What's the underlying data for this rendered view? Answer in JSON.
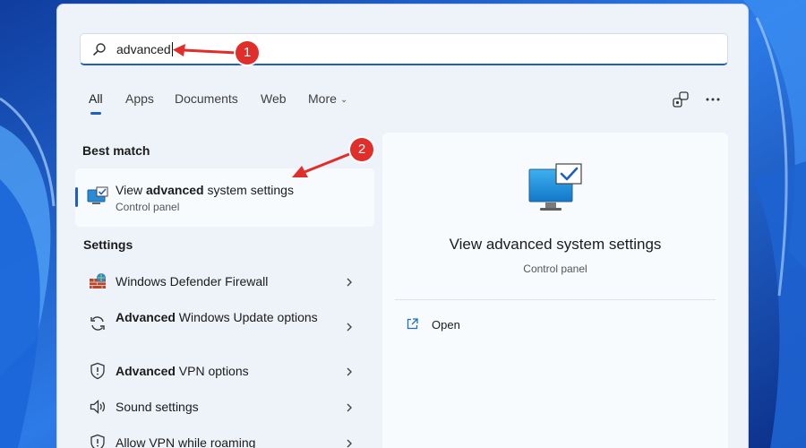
{
  "search": {
    "query": "advanced"
  },
  "tabs": [
    {
      "label": "All",
      "active": true
    },
    {
      "label": "Apps"
    },
    {
      "label": "Documents"
    },
    {
      "label": "Web"
    },
    {
      "label": "More"
    }
  ],
  "best_match": {
    "header": "Best match",
    "title_prefix": "View ",
    "title_highlight": "advanced",
    "title_suffix": " system settings",
    "subtitle": "Control panel"
  },
  "settings": {
    "header": "Settings",
    "items": [
      {
        "highlight": "",
        "label": "Windows Defender Firewall",
        "icon": "firewall-icon"
      },
      {
        "highlight": "Advanced",
        "label": " Windows Update options",
        "icon": "sync-icon"
      },
      {
        "highlight": "Advanced",
        "label": " VPN options",
        "icon": "shield-icon"
      },
      {
        "highlight": "",
        "label": "Sound settings",
        "icon": "speaker-icon"
      },
      {
        "highlight": "",
        "label": "Allow VPN while roaming",
        "icon": "shield-icon"
      }
    ]
  },
  "preview": {
    "title": "View advanced system settings",
    "subtitle": "Control panel",
    "actions": [
      {
        "label": "Open",
        "icon": "open-external-icon"
      }
    ]
  },
  "annotations": [
    {
      "number": "1"
    },
    {
      "number": "2"
    }
  ],
  "colors": {
    "accent": "#1f5fbf",
    "annotation": "#e02e2a"
  }
}
